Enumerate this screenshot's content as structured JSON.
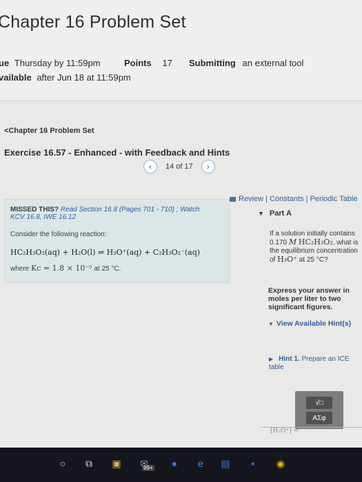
{
  "header": {
    "title": "Chapter 16 Problem Set",
    "due_label": "ue",
    "due_value": "Thursday by 11:59pm",
    "points_label": "Points",
    "points_value": "17",
    "submitting_label": "Submitting",
    "submitting_value": "an external tool",
    "available_label": "vailable",
    "available_value": "after Jun 18 at 11:59pm"
  },
  "nav": {
    "breadcrumb": "Chapter 16 Problem Set",
    "exercise_title": "Exercise 16.57 - Enhanced - with Feedback and Hints",
    "pager_text": "14 of 17"
  },
  "problem": {
    "missed_bold": "MISSED THIS?",
    "missed_text": "Read Section 16.8 (Pages 701 - 710) ; Watch",
    "missed_link": "KCV 16.8, IWE 16.12",
    "consider": "Consider the following reaction:",
    "equation": "HC₂H₃O₂(aq) + H₂O(l) ⇌ H₃O⁺(aq) + C₂H₃O₂⁻(aq)",
    "where_prefix": "where",
    "kc_expr": "Kc = 1.8 × 10⁻⁵",
    "at_temp": "at 25 °C."
  },
  "side": {
    "review": "Review",
    "constants": "Constants",
    "periodic_table": "Periodic Table",
    "part": "Part A",
    "question_1": "If a solution initially contains 0.170",
    "question_unit": "M",
    "question_2": "HC₂H₃O₂",
    "question_3": ", what is the equilibrium concentration of",
    "question_4": "H₃O⁺",
    "question_5": "at 25 °C?",
    "instructions": "Express your answer in moles per liter to two significant figures.",
    "view_hints": "View Available Hint(s)",
    "hint_label": "Hint 1.",
    "hint_text": "Prepare an ICE table",
    "tool_1": "√□",
    "tool_2": "ΑΣφ",
    "answer_peek": "[H₃O⁺] ="
  },
  "taskbar": {
    "badge": "99+"
  }
}
